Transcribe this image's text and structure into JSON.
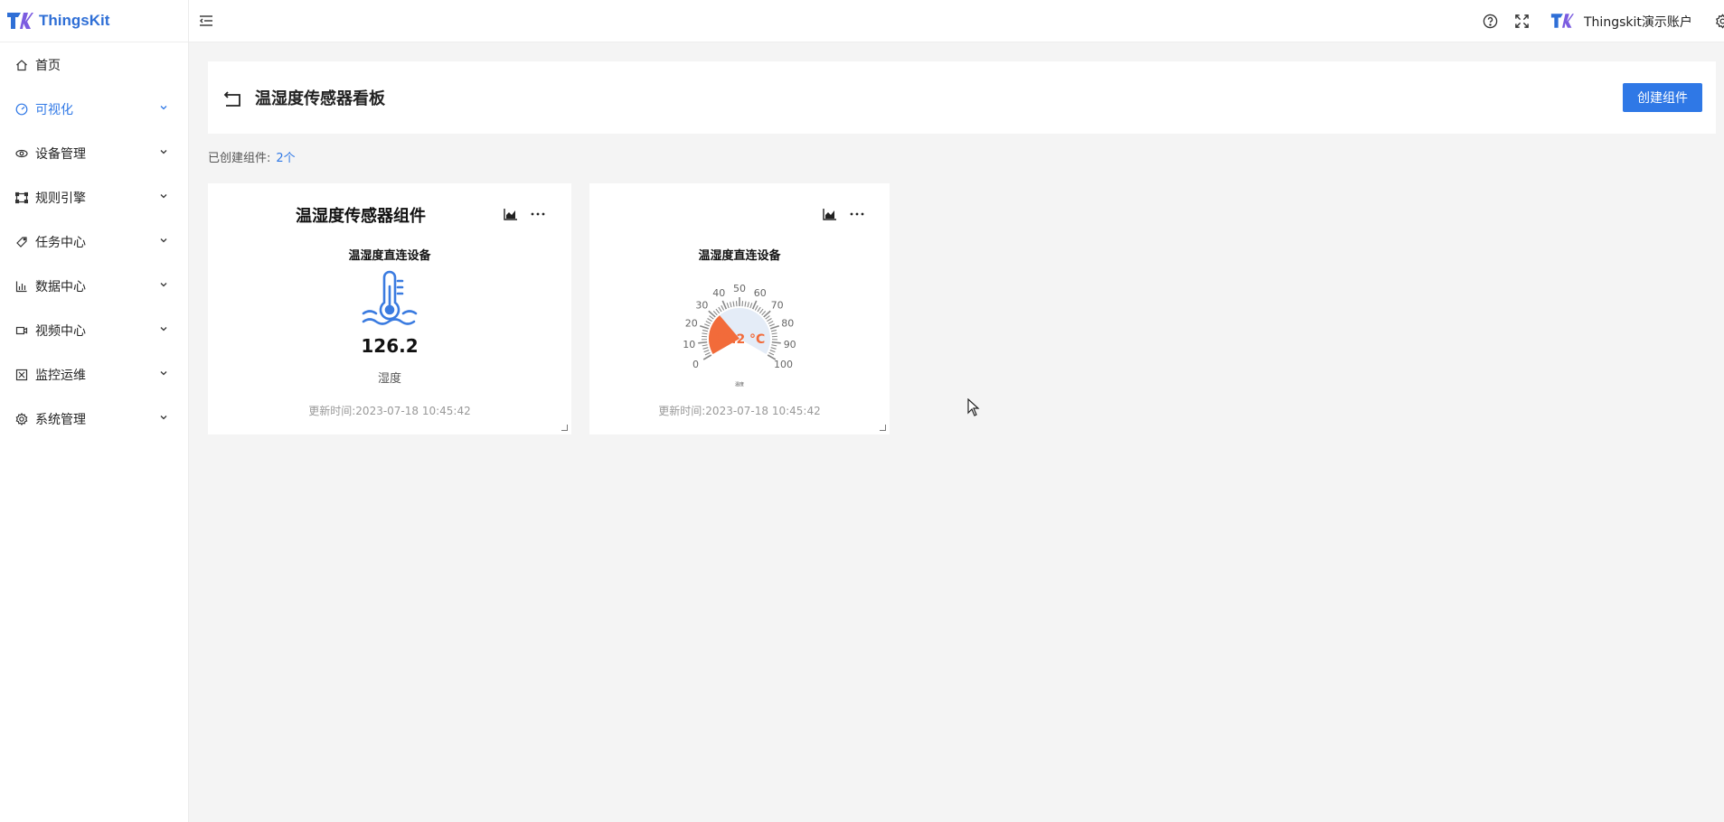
{
  "app": {
    "brand": "ThingsKit"
  },
  "sidebar": {
    "items": [
      {
        "label": "首页",
        "icon": "home-icon",
        "active": false,
        "expandable": false
      },
      {
        "label": "可视化",
        "icon": "dashboard-icon",
        "active": true,
        "expandable": true
      },
      {
        "label": "设备管理",
        "icon": "device-icon",
        "active": false,
        "expandable": true
      },
      {
        "label": "规则引擎",
        "icon": "rule-icon",
        "active": false,
        "expandable": true
      },
      {
        "label": "任务中心",
        "icon": "tag-icon",
        "active": false,
        "expandable": true
      },
      {
        "label": "数据中心",
        "icon": "bar-chart-icon",
        "active": false,
        "expandable": true
      },
      {
        "label": "视频中心",
        "icon": "video-icon",
        "active": false,
        "expandable": true
      },
      {
        "label": "监控运维",
        "icon": "monitor-icon",
        "active": false,
        "expandable": true
      },
      {
        "label": "系统管理",
        "icon": "gear-icon",
        "active": false,
        "expandable": true
      }
    ]
  },
  "header": {
    "user_name": "Thingskit演示账户"
  },
  "page": {
    "title": "温湿度传感器看板",
    "create_button": "创建组件",
    "created_label": "已创建组件:",
    "created_count": "2个"
  },
  "widgets": [
    {
      "title": "温湿度传感器组件",
      "device": "温湿度直连设备",
      "value": "126.2",
      "value_label": "湿度",
      "updated": "更新时间:2023-07-18 10:45:42",
      "icon": "thermometer-icon"
    },
    {
      "title": "",
      "device": "温湿度直连设备",
      "value": "33.2 °C",
      "gauge_value": 33.2,
      "gauge_min": 0,
      "gauge_max": 100,
      "gauge_ticks": [
        "0",
        "10",
        "20",
        "30",
        "40",
        "50",
        "60",
        "70",
        "80",
        "90",
        "100"
      ],
      "gauge_label": "温度",
      "updated": "更新时间:2023-07-18 10:45:42"
    }
  ],
  "colors": {
    "accent": "#2f78e6",
    "gauge_fill": "#f26b3a",
    "gauge_track": "#e4ecf7",
    "icon_blue": "#3a7be0"
  }
}
